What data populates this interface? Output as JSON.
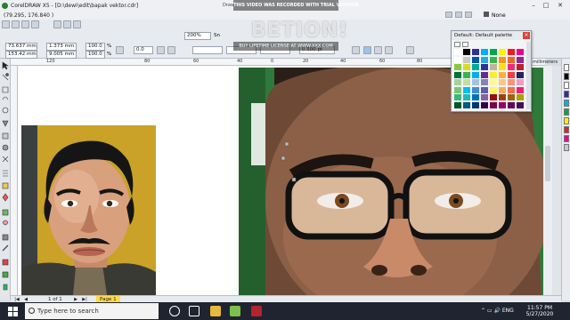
{
  "window": {
    "title": "CorelDRAW X5 - [D:\\dewi\\edit\\bapak vektor.cdr]",
    "doc_title": "Draw",
    "trial_banner": "THIS VIDEO WAS RECORDED WITH TRIAL VERSION",
    "watermark": "BETION!",
    "buy_banner": "BUY LIFETIME LICENSE AT WWW.XXX.COM",
    "minimize": "–",
    "maximize": "□",
    "close": "✕"
  },
  "status": {
    "cursor_position": "(79.295, 176.840 )",
    "outline_none": "None"
  },
  "property_bar": {
    "x_value": "73.637 mm",
    "y_value": "153.42 mm",
    "width_value": "1.373 mm",
    "height_value": "9.005 mm",
    "scale_x": "100.0",
    "scale_y": "100.0",
    "percent": "%",
    "rotation": "0.0",
    "zoom": "200%",
    "snap_label": "Sn",
    "nudge": "0.025 mm",
    "outline_width": "0.500 pt",
    "units": "millimeters"
  },
  "ruler": {
    "ticks": [
      "120",
      "80",
      "60",
      "40",
      "0",
      "20",
      "40",
      "60",
      "80",
      "100"
    ]
  },
  "palette_docker": {
    "title": "Default: Default palette",
    "colors": [
      "#ffffff",
      "#000000",
      "#2e3192",
      "#00aeef",
      "#00a651",
      "#fff200",
      "#ed1c24",
      "#ec008c",
      "#ffffff",
      "#c7c7c7",
      "#0054a6",
      "#29abe2",
      "#39b54a",
      "#f7941d",
      "#f26522",
      "#92278f",
      "#8dc63f",
      "#d7df23",
      "#00a99d",
      "#2e3192",
      "#c2b59b",
      "#ffde17",
      "#ee2a7b",
      "#be1e2d",
      "#007236",
      "#39b54a",
      "#00aeef",
      "#662d91",
      "#f9ed32",
      "#fbb040",
      "#ef4136",
      "#262262",
      "#a3d39c",
      "#c4df9b",
      "#a3c2e3",
      "#8781bd",
      "#fff799",
      "#fdc689",
      "#f69679",
      "#f49ac1",
      "#7cc576",
      "#00bff3",
      "#448ccb",
      "#605ca8",
      "#fff568",
      "#f8ac59",
      "#f26c4f",
      "#ed1e79",
      "#3cb878",
      "#1cbbb4",
      "#0072bc",
      "#8560a8",
      "#9e0b0f",
      "#a0410d",
      "#a3620a",
      "#aba000",
      "#005826",
      "#005b7f",
      "#003471",
      "#32004b",
      "#7b0046",
      "#9e005d",
      "#630460",
      "#440e62"
    ],
    "row_cols": 8
  },
  "page_nav": {
    "page_count": "1 of 1",
    "page_tab": "Page 1"
  },
  "taskbar": {
    "search_placeholder": "Type here to search",
    "time": "11:57 PM",
    "date": "5/27/2020",
    "tray_icons": "⌃ ▭ 🔊 ENG"
  }
}
